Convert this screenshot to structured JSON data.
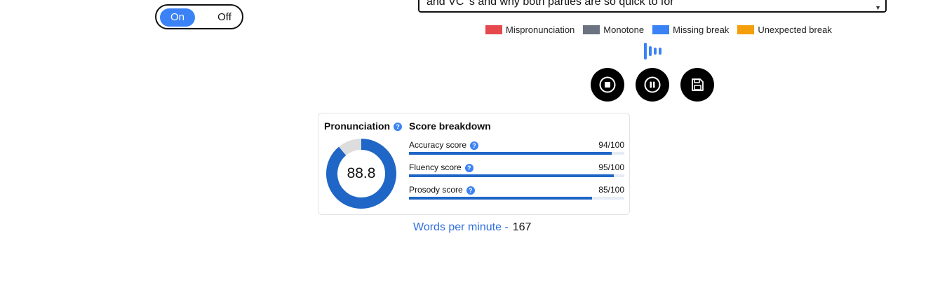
{
  "toggle": {
    "on_label": "On",
    "off_label": "Off",
    "selected": "On"
  },
  "text_input": {
    "value": "and VC 's and why both parties are so quick to for"
  },
  "legend": [
    {
      "label": "Mispronunciation",
      "color": "#e5484d"
    },
    {
      "label": "Monotone",
      "color": "#6b7280"
    },
    {
      "label": "Missing break",
      "color": "#3b82f6"
    },
    {
      "label": "Unexpected break",
      "color": "#f59e0b"
    }
  ],
  "controls": {
    "icons": [
      "stop-icon",
      "pause-icon",
      "save-icon"
    ]
  },
  "pronunciation": {
    "title": "Pronunciation",
    "score": "88.8",
    "score_fraction": 0.888
  },
  "breakdown": {
    "title": "Score breakdown",
    "items": [
      {
        "label": "Accuracy score",
        "value": "94/100",
        "fraction": 0.94
      },
      {
        "label": "Fluency score",
        "value": "95/100",
        "fraction": 0.95
      },
      {
        "label": "Prosody score",
        "value": "85/100",
        "fraction": 0.85
      }
    ]
  },
  "wpm": {
    "label": "Words per minute -",
    "value": "167"
  },
  "colors": {
    "accent": "#3b82f6",
    "bar": "#1f66c6",
    "donut_fill": "#1f66c6",
    "donut_track": "#dddddd"
  }
}
